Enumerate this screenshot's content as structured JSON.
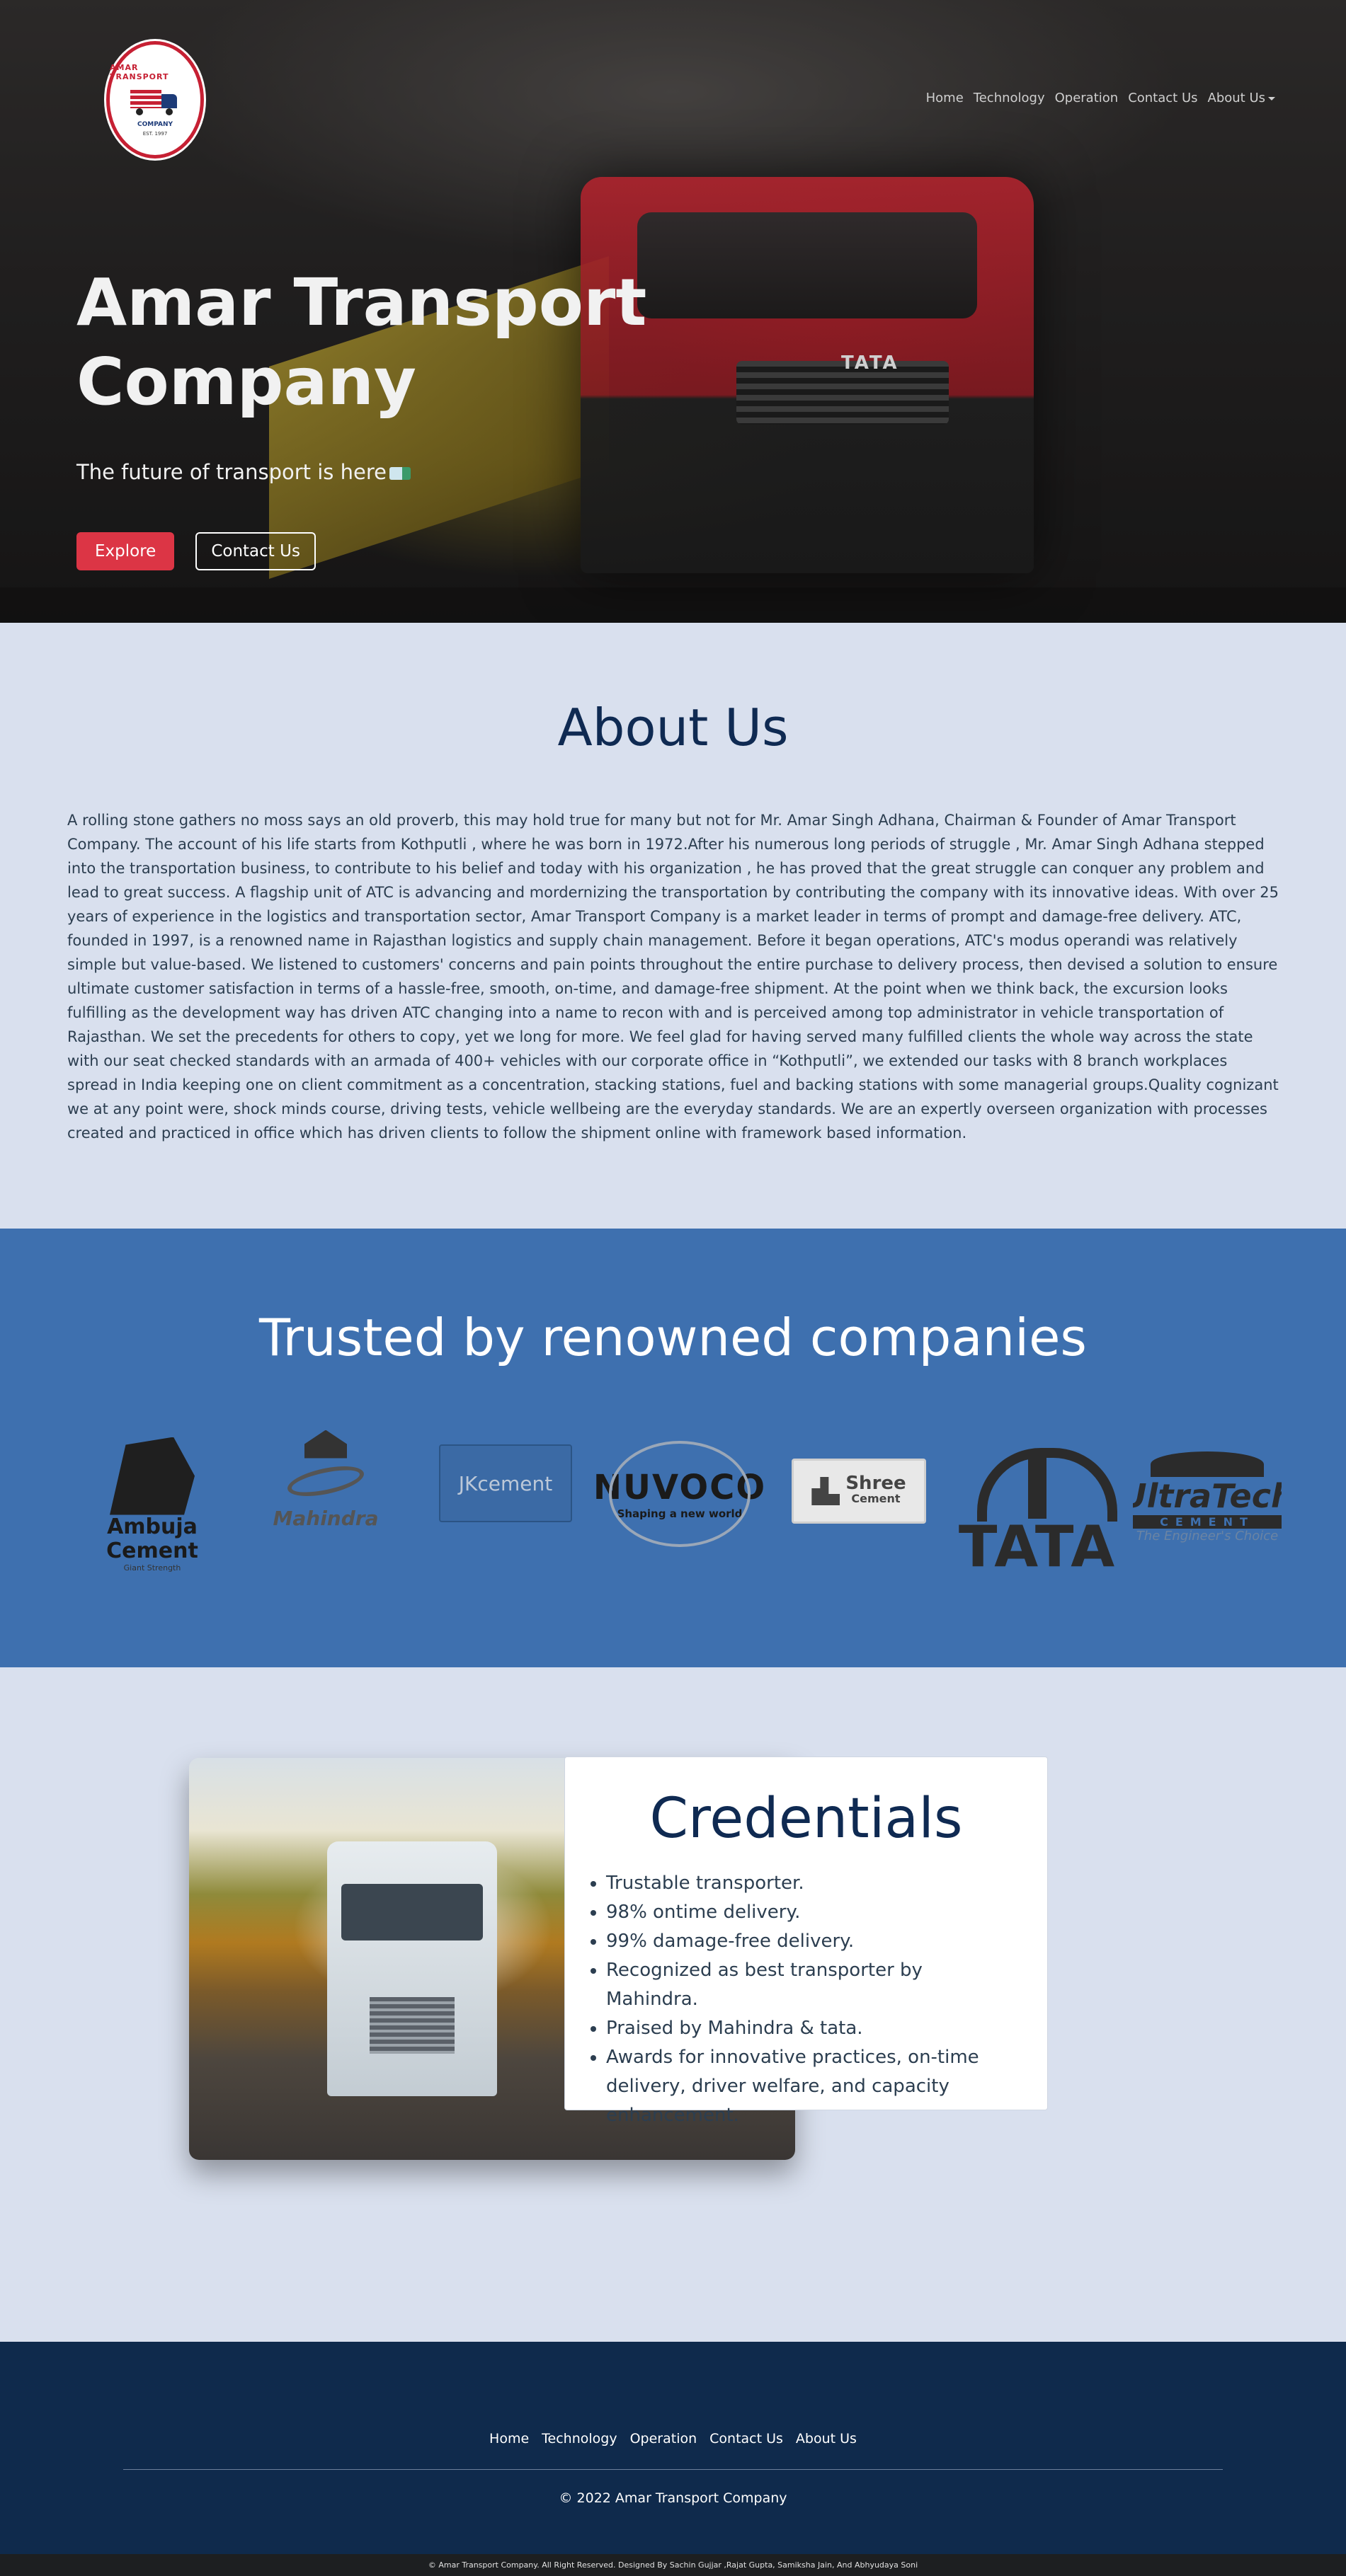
{
  "brand": {
    "logo_top": "AMAR TRANSPORT",
    "logo_bottom": "COMPANY",
    "logo_est": "EST. 1997"
  },
  "nav": {
    "home": "Home",
    "technology": "Technology",
    "operation": "Operation",
    "contact": "Contact Us",
    "about": "About Us"
  },
  "hero": {
    "title": "Amar Transport Company",
    "subtitle": "The future of transport is here",
    "explore_label": "Explore",
    "contact_label": "Contact Us",
    "truck_badge": "TATA"
  },
  "about": {
    "heading": "About Us",
    "body": "A rolling stone gathers no moss says an old proverb, this may hold true for many but not for Mr. Amar Singh Adhana, Chairman & Founder of Amar Transport Company. The account of his life starts from Kothputli , where he was born in 1972.After his numerous long periods of struggle , Mr. Amar Singh Adhana stepped into the transportation business, to contribute to his belief and today with his organization , he has proved that the great struggle can conquer any problem and lead to great success. A flagship unit of ATC is advancing and mordernizing the transportation by contributing the company with its innovative ideas. With over 25 years of experience in the logistics and transportation sector, Amar Transport Company is a market leader in terms of prompt and damage-free delivery. ATC, founded in 1997, is a renowned name in Rajasthan logistics and supply chain management. Before it began operations, ATC's modus operandi was relatively simple but value-based. We listened to customers' concerns and pain points throughout the entire purchase to delivery process, then devised a solution to ensure ultimate customer satisfaction in terms of a hassle-free, smooth, on-time, and damage-free shipment. At the point when we think back, the excursion looks fulfilling as the development way has driven ATC changing into a name to recon with and is perceived among top administrator in vehicle transportation of Rajasthan. We set the precedents for others to copy, yet we long for more. We feel glad for having served many fulfilled clients the whole way across the state with our seat checked standards with an armada of 400+ vehicles with our corporate office in “Kothputli”, we extended our tasks with 8 branch workplaces spread in India keeping one on client commitment as a concentration, stacking stations, fuel and backing stations with some managerial groups.Quality cognizant we at any point were, shock minds course, driving tests, vehicle wellbeing are the everyday standards. We are an expertly overseen organization with processes created and practiced in office which has driven clients to follow the shipment online with framework based information."
  },
  "trusted": {
    "heading": "Trusted by renowned companies",
    "logos": {
      "ambuja": {
        "name": "Ambuja Cement",
        "tagline": "Giant Strength"
      },
      "mahindra": {
        "name": "Mahindra"
      },
      "jk": {
        "name": "JKcement"
      },
      "nuvoco": {
        "name": "NUVOCO",
        "tagline": "Shaping a new world"
      },
      "shree": {
        "name": "Shree",
        "sub": "Cement"
      },
      "tata": {
        "name": "TATA"
      },
      "ultratech": {
        "name": "UltraTech",
        "sub": "CEMENT",
        "tagline": "The Engineer's Choice"
      }
    }
  },
  "credentials": {
    "heading": "Credentials",
    "items": [
      "Trustable transporter.",
      "98% ontime delivery.",
      "99% damage-free delivery.",
      "Recognized as best transporter by Mahindra.",
      "Praised by Mahindra & tata.",
      "Awards for innovative practices, on-time delivery, driver welfare, and capacity enhancement."
    ]
  },
  "footer": {
    "nav": [
      "Home",
      "Technology",
      "Operation",
      "Contact Us",
      "About Us"
    ],
    "copyright": "© 2022 Amar Transport Company",
    "credits": "© Amar Transport Company. All Right Reserved. Designed By Sachin Gujjar ,Rajat Gupta, Samiksha Jain, And Abhyudaya Soni"
  },
  "colors": {
    "accent_red": "#dc3545",
    "navy": "#0f2a52",
    "section_blue": "#3e70af",
    "page_bg": "#d9e0ee",
    "footer_bg": "#0f2a4c"
  }
}
